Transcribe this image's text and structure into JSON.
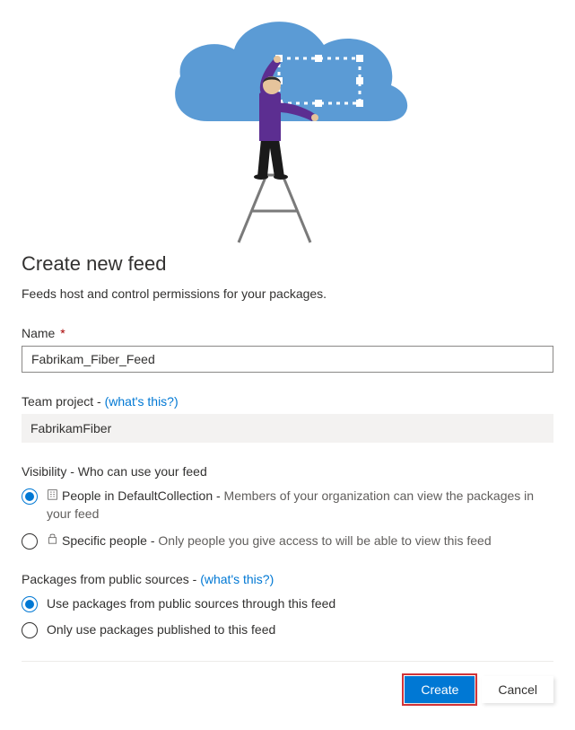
{
  "title": "Create new feed",
  "subtitle": "Feeds host and control permissions for your packages.",
  "name": {
    "label": "Name",
    "required_marker": "*",
    "value": "Fabrikam_Fiber_Feed"
  },
  "team_project": {
    "label": "Team project - ",
    "help_link": "(what's this?)",
    "value": "FabrikamFiber"
  },
  "visibility": {
    "label": "Visibility - Who can use your feed",
    "options": [
      {
        "selected": true,
        "icon": "org-icon",
        "prefix": "People in DefaultCollection - ",
        "desc": "Members of your organization can view the packages in your feed"
      },
      {
        "selected": false,
        "icon": "lock-icon",
        "prefix": "Specific people - ",
        "desc": "Only people you give access to will be able to view this feed"
      }
    ]
  },
  "public_sources": {
    "label": "Packages from public sources - ",
    "help_link": "(what's this?)",
    "options": [
      {
        "selected": true,
        "label": "Use packages from public sources through this feed"
      },
      {
        "selected": false,
        "label": "Only use packages published to this feed"
      }
    ]
  },
  "actions": {
    "create": "Create",
    "cancel": "Cancel"
  }
}
